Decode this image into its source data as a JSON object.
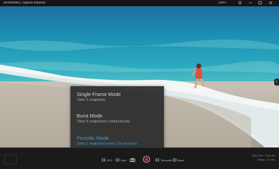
{
  "window": {
    "title": "MAGEWELL Capture Express",
    "zoom": "100%"
  },
  "mode_menu": {
    "options": [
      {
        "title": "Single-Frame Mode",
        "desc": "Take 1 snapshot",
        "selected": false
      },
      {
        "title": "Burst Mode",
        "desc": "Take 5 snapshots continuously",
        "selected": false
      },
      {
        "title": "Periodic Mode",
        "desc": "Take 1 snapshot every 10 seconds",
        "selected": true
      }
    ]
  },
  "toolbar": {
    "items": [
      {
        "label": "JPG",
        "icon": "image-icon"
      },
      {
        "label": "Gain",
        "icon": "adjust-icon"
      },
      {
        "label": "",
        "icon": "camera-icon"
      },
      {
        "label": "",
        "icon": "record-icon"
      },
      {
        "label": "Timeshift",
        "icon": "timeshift-icon"
      },
      {
        "label": "Mark",
        "icon": "mark-icon"
      }
    ],
    "info_top": "Disk Free · Time left",
    "info_bottom": "1Mbps · 01:005"
  },
  "colors": {
    "accent": "#3a9ee6",
    "record": "#e02020"
  }
}
